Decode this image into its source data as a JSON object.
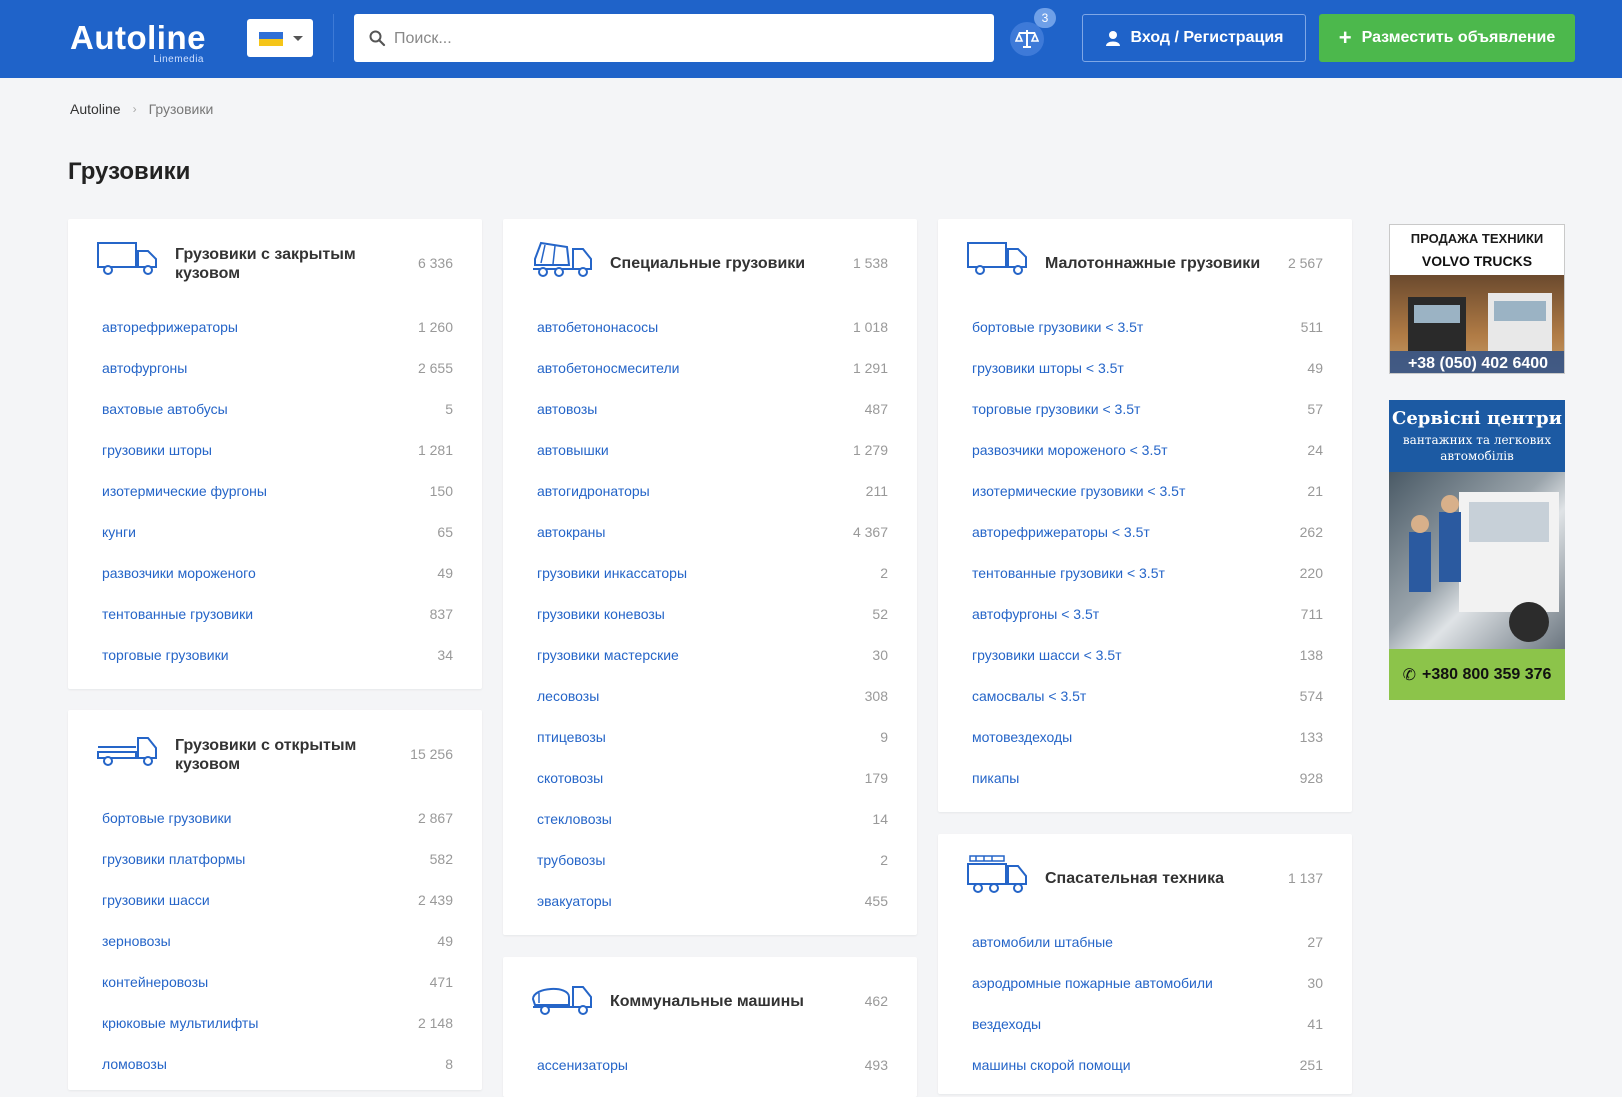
{
  "header": {
    "logo_main": "Autoline",
    "logo_sub": "Linemedia",
    "search_placeholder": "Поиск...",
    "compare_badge": "3",
    "login_label": "Вход / Регистрация",
    "post_label": "Разместить объявление",
    "colors": {
      "bar": "#1f63c9",
      "post_button": "#4cb84c"
    }
  },
  "breadcrumb": {
    "home": "Autoline",
    "current": "Грузовики"
  },
  "page_title": "Грузовики",
  "cards": {
    "closed": {
      "title": "Грузовики с закрытым кузовом",
      "count": "6 336",
      "items": [
        {
          "label": "авторефрижераторы",
          "count": "1 260"
        },
        {
          "label": "автофургоны",
          "count": "2 655"
        },
        {
          "label": "вахтовые автобусы",
          "count": "5"
        },
        {
          "label": "грузовики шторы",
          "count": "1 281"
        },
        {
          "label": "изотермические фургоны",
          "count": "150"
        },
        {
          "label": "кунги",
          "count": "65"
        },
        {
          "label": "развозчики мороженого",
          "count": "49"
        },
        {
          "label": "тентованные грузовики",
          "count": "837"
        },
        {
          "label": "торговые грузовики",
          "count": "34"
        }
      ]
    },
    "open": {
      "title": "Грузовики с открытым кузовом",
      "count": "15 256",
      "items": [
        {
          "label": "бортовые грузовики",
          "count": "2 867"
        },
        {
          "label": "грузовики платформы",
          "count": "582"
        },
        {
          "label": "грузовики шасси",
          "count": "2 439"
        },
        {
          "label": "зерновозы",
          "count": "49"
        },
        {
          "label": "контейнеровозы",
          "count": "471"
        },
        {
          "label": "крюковые мультилифты",
          "count": "2 148"
        },
        {
          "label": "ломовозы",
          "count": "8"
        }
      ]
    },
    "special": {
      "title": "Специальные грузовики",
      "count": "1 538",
      "items": [
        {
          "label": "автобетононасосы",
          "count": "1 018"
        },
        {
          "label": "автобетоносмесители",
          "count": "1 291"
        },
        {
          "label": "автовозы",
          "count": "487"
        },
        {
          "label": "автовышки",
          "count": "1 279"
        },
        {
          "label": "автогидронаторы",
          "count": "211"
        },
        {
          "label": "автокраны",
          "count": "4 367"
        },
        {
          "label": "грузовики инкассаторы",
          "count": "2"
        },
        {
          "label": "грузовики коневозы",
          "count": "52"
        },
        {
          "label": "грузовики мастерские",
          "count": "30"
        },
        {
          "label": "лесовозы",
          "count": "308"
        },
        {
          "label": "птицевозы",
          "count": "9"
        },
        {
          "label": "скотовозы",
          "count": "179"
        },
        {
          "label": "стекловозы",
          "count": "14"
        },
        {
          "label": "трубовозы",
          "count": "2"
        },
        {
          "label": "эвакуаторы",
          "count": "455"
        }
      ]
    },
    "communal": {
      "title": "Коммунальные машины",
      "count": "462",
      "items": [
        {
          "label": "ассенизаторы",
          "count": "493"
        }
      ]
    },
    "light": {
      "title": "Малотоннажные грузовики",
      "count": "2 567",
      "items": [
        {
          "label": "бортовые грузовики < 3.5т",
          "count": "511"
        },
        {
          "label": "грузовики шторы < 3.5т",
          "count": "49"
        },
        {
          "label": "торговые грузовики < 3.5т",
          "count": "57"
        },
        {
          "label": "развозчики мороженого < 3.5т",
          "count": "24"
        },
        {
          "label": "изотермические грузовики < 3.5т",
          "count": "21"
        },
        {
          "label": "авторефрижераторы < 3.5т",
          "count": "262"
        },
        {
          "label": "тентованные грузовики < 3.5т",
          "count": "220"
        },
        {
          "label": "автофургоны < 3.5т",
          "count": "711"
        },
        {
          "label": "грузовики шасси < 3.5т",
          "count": "138"
        },
        {
          "label": "самосвалы < 3.5т",
          "count": "574"
        },
        {
          "label": "мотовездеходы",
          "count": "133"
        },
        {
          "label": "пикапы",
          "count": "928"
        }
      ]
    },
    "rescue": {
      "title": "Спасательная техника",
      "count": "1 137",
      "items": [
        {
          "label": "автомобили штабные",
          "count": "27"
        },
        {
          "label": "аэродромные пожарные автомобили",
          "count": "30"
        },
        {
          "label": "вездеходы",
          "count": "41"
        },
        {
          "label": "машины скорой помощи",
          "count": "251"
        }
      ]
    }
  },
  "ads": {
    "volvo": {
      "title": "ПРОДАЖА ТЕХНИКИ",
      "brand": "VOLVO TRUCKS",
      "phone": "+38 (050) 402 6400"
    },
    "service": {
      "title": "Сервісні центри",
      "subtitle": "вантажних та легкових автомобілів",
      "phone": "+380 800 359 376"
    }
  }
}
